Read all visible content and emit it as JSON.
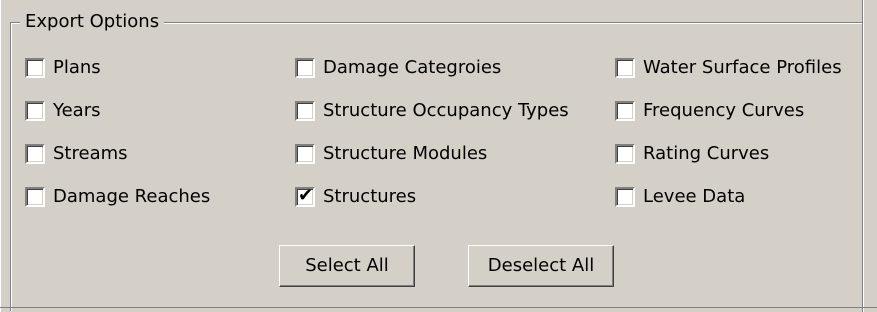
{
  "group": {
    "title": "Export Options"
  },
  "options": {
    "col1": [
      {
        "label": "Plans",
        "checked": false
      },
      {
        "label": "Years",
        "checked": false
      },
      {
        "label": "Streams",
        "checked": false
      },
      {
        "label": "Damage Reaches",
        "checked": false
      }
    ],
    "col2": [
      {
        "label": "Damage Categroies",
        "checked": false
      },
      {
        "label": "Structure Occupancy Types",
        "checked": false
      },
      {
        "label": "Structure Modules",
        "checked": false
      },
      {
        "label": "Structures",
        "checked": true
      }
    ],
    "col3": [
      {
        "label": "Water Surface Profiles",
        "checked": false
      },
      {
        "label": "Frequency Curves",
        "checked": false
      },
      {
        "label": "Rating Curves",
        "checked": false
      },
      {
        "label": "Levee Data",
        "checked": false
      }
    ]
  },
  "buttons": {
    "select_all": "Select All",
    "deselect_all": "Deselect All"
  },
  "colors": {
    "face": "#d4d0c8",
    "shadow": "#808080",
    "highlight": "#ffffff"
  }
}
